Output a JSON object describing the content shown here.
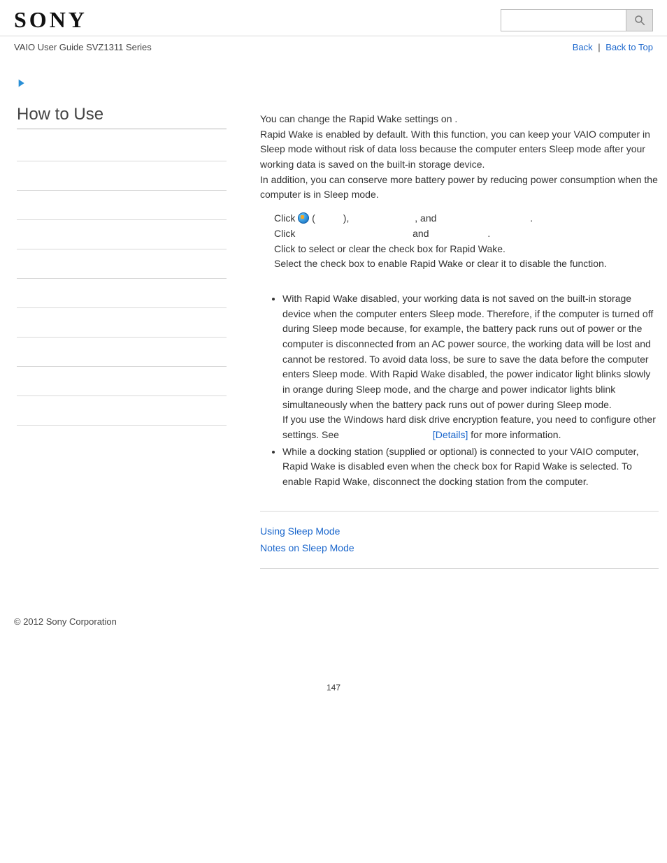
{
  "header": {
    "logo": "SONY",
    "search_placeholder": ""
  },
  "sub_header": {
    "title": "VAIO User Guide SVZ1311 Series",
    "back": "Back",
    "top": "Back to Top"
  },
  "sidebar": {
    "title": "How to Use"
  },
  "content": {
    "intro_line1_a": "You can change the Rapid Wake settings on ",
    "intro_line1_b": ".",
    "intro_rest": "Rapid Wake is enabled by default. With this function, you can keep your VAIO computer in Sleep mode without risk of data loss because the computer enters Sleep mode after your working data is saved on the built-in storage device.\nIn addition, you can conserve more battery power by reducing power consumption when the computer is in Sleep mode.",
    "step1_a": "Click ",
    "step1_b": " (",
    "step1_c": "), ",
    "step1_d": ", and ",
    "step1_e": ".",
    "step2_a": "Click ",
    "step2_b": " and ",
    "step2_c": ".",
    "step3": "Click to select or clear the check box for Rapid Wake.",
    "step3b": "Select the check box to enable Rapid Wake or clear it to disable the function.",
    "note1_a": "With Rapid Wake disabled, your working data is not saved on the built-in storage device when the computer enters Sleep mode. Therefore, if the computer is turned off during Sleep mode because, for example, the battery pack runs out of power or the computer is disconnected from an AC power source, the working data will be lost and cannot be restored. To avoid data loss, be sure to save the data before the computer enters Sleep mode. With Rapid Wake disabled, the power indicator light blinks slowly in orange during Sleep mode, and the charge and power indicator lights blink simultaneously when the battery pack runs out of power during Sleep mode.",
    "note1_b": "If you use the Windows hard disk drive encryption feature, you need to configure other settings. See ",
    "note1_details": "[Details]",
    "note1_c": " for more information.",
    "note2": "While a docking station (supplied or optional) is connected to your VAIO computer, Rapid Wake is disabled even when the check box for Rapid Wake is selected. To enable Rapid Wake, disconnect the docking station from the computer.",
    "related1": "Using Sleep Mode",
    "related2": "Notes on Sleep Mode"
  },
  "footer": {
    "copyright": "© 2012 Sony Corporation",
    "page": "147"
  }
}
